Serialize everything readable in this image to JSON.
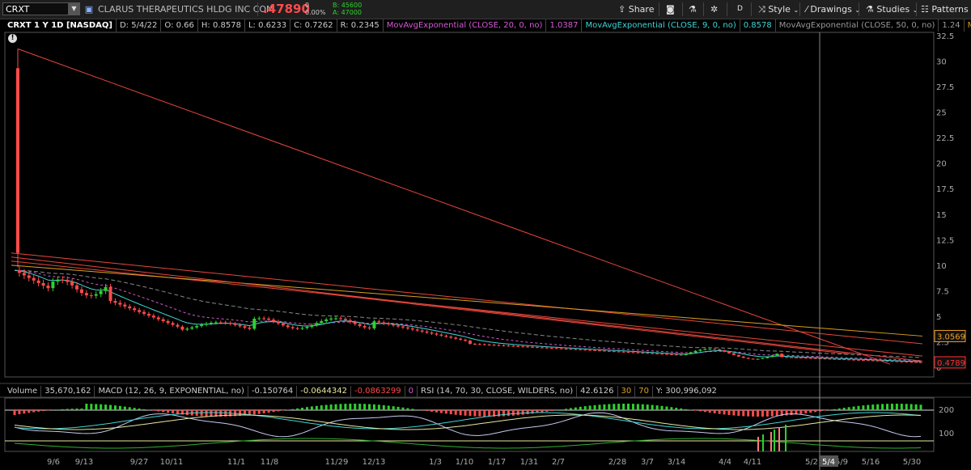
{
  "toolbar": {
    "symbol": "CRXT",
    "company": "CLARUS THERAPEUTICS HLDG INC COM",
    "last": ".47890",
    "change_top": "0",
    "change_pct": "0.00%",
    "bid": "B: 45600",
    "ask": "A: 47000",
    "share_label": "Share",
    "d_label": "D",
    "style_label": "Style",
    "drawings_label": "Drawings",
    "studies_label": "Studies",
    "patterns_label": "Patterns"
  },
  "info": {
    "title": "CRXT 1 Y 1D [NASDAQ]",
    "date": "D: 5/4/22",
    "open": "O: 0.66",
    "high": "H: 0.8578",
    "low": "L: 0.6233",
    "close": "C: 0.7262",
    "range": "R: 0.2345",
    "ema20": "MovAvgExponential (CLOSE, 20, 0, no)",
    "ema20_val": "1.0387",
    "ema9": "MovAvgExponential (CLOSE, 9, 0, no)",
    "ema9_val": "0.8578",
    "ema50": "MovAvgExponential (CLOSE, 50, 0, no)",
    "ema50_val": "1.24",
    "ema_more": "MovAvg..."
  },
  "lower": {
    "volume_label": "Volume",
    "volume_val": "35,670,162",
    "macd": "MACD (12, 26, 9, EXPONENTIAL, no)",
    "macd_v1": "-0.150764",
    "macd_v2": "-0.0644342",
    "macd_v3": "-0.0863299",
    "macd_v4": "0",
    "rsi": "RSI (14, 70, 30, CLOSE, WILDERS, no)",
    "rsi_val": "42.6126",
    "rsi_ob": "30",
    "rsi_os": "70",
    "y_val": "Y: 300,996,092"
  },
  "price_axis": {
    "ticks": [
      "32.5",
      "30",
      "27.5",
      "25",
      "22.5",
      "20",
      "17.5",
      "15",
      "12.5",
      "10",
      "7.5",
      "5",
      "2.5",
      "0"
    ],
    "trend_value": "3.0569",
    "last_value": "0.4789"
  },
  "lower_axis": {
    "ticks": [
      "200",
      "100"
    ]
  },
  "x_axis": {
    "ticks": [
      "9/6",
      "9/13",
      "9/27",
      "10/11",
      "11/1",
      "11/8",
      "11/29",
      "12/13",
      "1/3",
      "1/10",
      "1/17",
      "1/31",
      "2/7",
      "2/28",
      "3/7",
      "3/14",
      "4/4",
      "4/11",
      "5/2",
      "5/9",
      "5/16",
      "5/30"
    ],
    "cursor_label": "5/4"
  },
  "colors": {
    "price_down": "#ff4a4a",
    "up": "#2fd12f",
    "ema9": "#3fd6d6",
    "ema20": "#d65bd6",
    "ema50": "#888888",
    "trend_red": "#e8473c",
    "trend_yellow": "#d9a21f",
    "value_box": "#f0a020",
    "last_box": "#ff3030"
  },
  "chart_data": {
    "type": "candlestick",
    "series": [
      {
        "name": "MovAvgExponential (CLOSE, 9, 0, no)",
        "last": 0.8578
      },
      {
        "name": "MovAvgExponential (CLOSE, 20, 0, no)",
        "last": 1.0387
      },
      {
        "name": "MovAvgExponential (CLOSE, 50, 0, no)",
        "last": 1.24
      }
    ],
    "ylim": [
      0,
      32.5
    ],
    "ohlc_selected": {
      "date": "5/4/22",
      "open": 0.66,
      "high": 0.8578,
      "low": 0.6233,
      "close": 0.7262
    },
    "last_price": 0.4789,
    "lower_ylim": [
      0,
      250
    ],
    "grid": false
  }
}
